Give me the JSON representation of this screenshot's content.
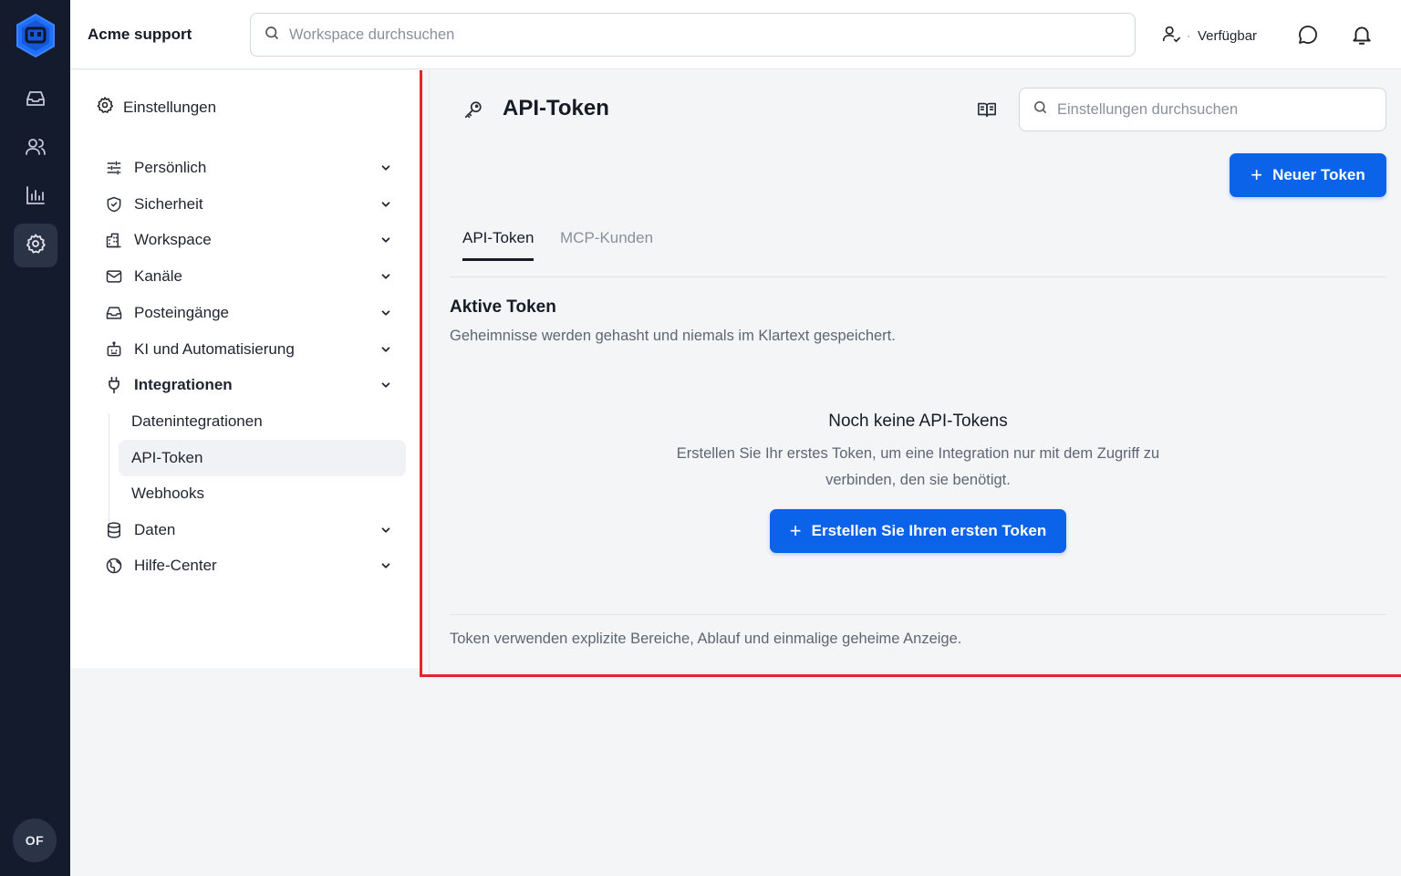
{
  "app": {
    "workspace_name": "Acme support",
    "user_initials": "OF"
  },
  "rail": {
    "items": [
      {
        "name": "inbox-icon",
        "active": false
      },
      {
        "name": "contacts-icon",
        "active": false
      },
      {
        "name": "reports-icon",
        "active": false
      },
      {
        "name": "settings-icon",
        "active": true
      }
    ]
  },
  "topbar": {
    "search_placeholder": "Workspace durchsuchen",
    "status_label": "Verfügbar",
    "status_separator": "·"
  },
  "settings_nav": {
    "header": "Einstellungen",
    "items": [
      {
        "label": "Persönlich",
        "icon": "sliders-icon"
      },
      {
        "label": "Sicherheit",
        "icon": "shield-icon"
      },
      {
        "label": "Workspace",
        "icon": "building-icon"
      },
      {
        "label": "Kanäle",
        "icon": "mail-icon"
      },
      {
        "label": "Posteingänge",
        "icon": "inbox-icon"
      },
      {
        "label": "KI und Automatisierung",
        "icon": "bot-icon"
      },
      {
        "label": "Integrationen",
        "icon": "plug-icon",
        "expanded": true
      },
      {
        "label": "Daten",
        "icon": "database-icon"
      },
      {
        "label": "Hilfe-Center",
        "icon": "globe-icon"
      }
    ],
    "sub_items": [
      {
        "label": "Datenintegrationen",
        "active": false
      },
      {
        "label": "API-Token",
        "active": true
      },
      {
        "label": "Webhooks",
        "active": false
      }
    ]
  },
  "main": {
    "title": "API-Token",
    "search_placeholder": "Einstellungen durchsuchen",
    "new_button": "Neuer Token",
    "tabs": [
      {
        "label": "API-Token",
        "active": true
      },
      {
        "label": "MCP-Kunden",
        "active": false
      }
    ],
    "section_title": "Aktive Token",
    "section_subtitle": "Geheimnisse werden gehasht und niemals im Klartext gespeichert.",
    "empty_title": "Noch keine API-Tokens",
    "empty_description": "Erstellen Sie Ihr erstes Token, um eine Integration nur mit dem Zugriff zu verbinden, den sie benötigt.",
    "cta_button": "Erstellen Sie Ihren ersten Token",
    "footer_note": "Token verwenden explizite Bereiche, Ablauf und einmalige geheime Anzeige."
  },
  "colors": {
    "rail_bg": "#141b2d",
    "primary": "#0b63ea",
    "highlight_border": "#e2262b"
  }
}
